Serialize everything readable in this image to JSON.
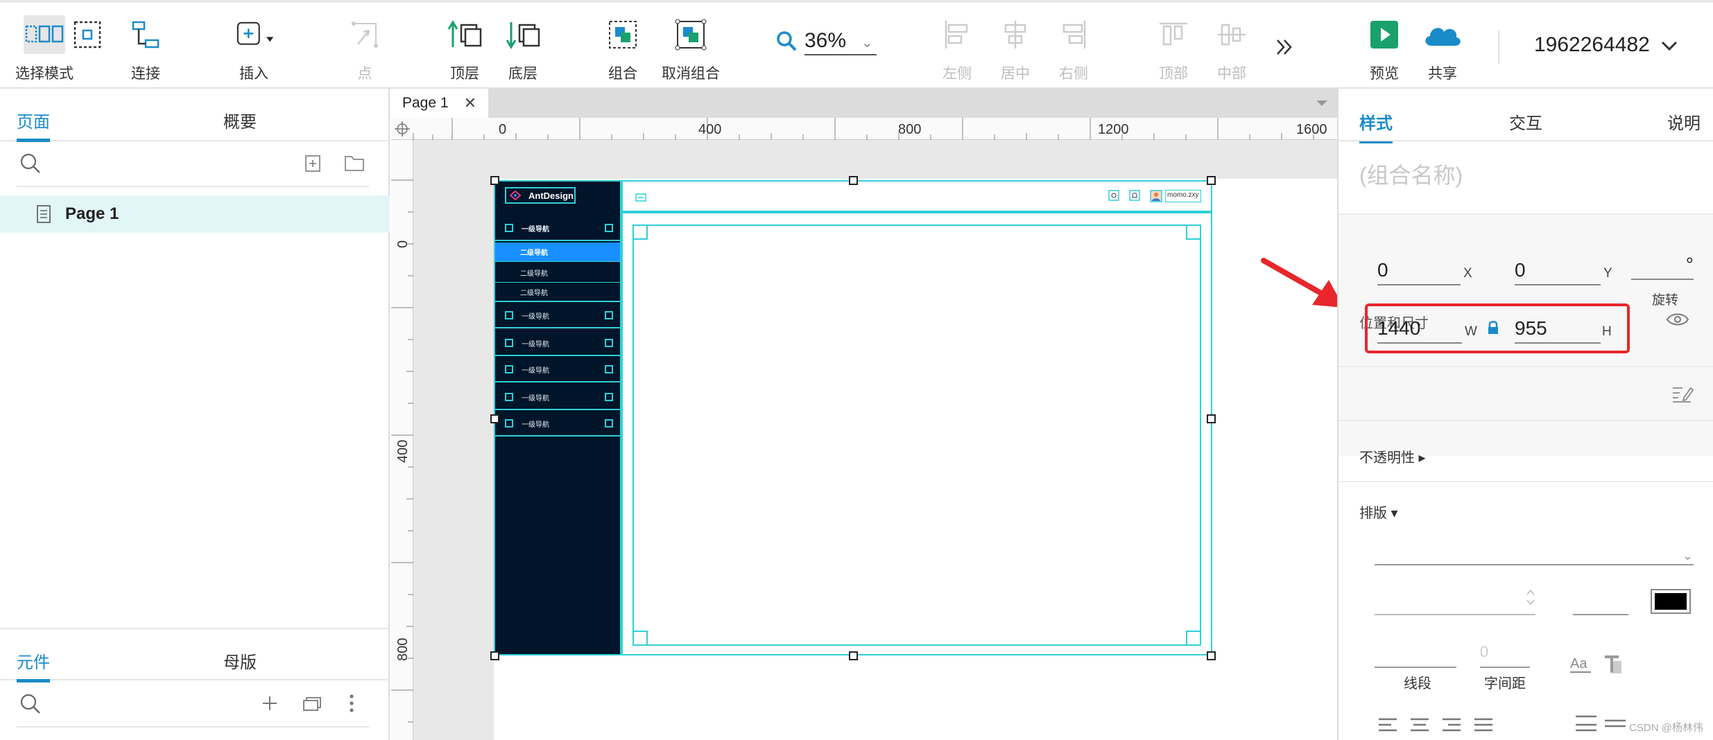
{
  "toolbar": {
    "tools": {
      "select_mode": "选择模式",
      "connect": "连接",
      "insert": "插入",
      "point": "点",
      "top_layer": "顶层",
      "bottom_layer": "底层",
      "group": "组合",
      "ungroup": "取消组合",
      "align_left": "左侧",
      "align_center": "居中",
      "align_right": "右侧",
      "align_top": "顶部",
      "align_middle": "中部",
      "preview": "预览",
      "share": "共享"
    },
    "zoom": "36%",
    "account": "1962264482",
    "accent": "#1a8bc9"
  },
  "left_panel": {
    "tabs": {
      "pages": "页面",
      "outline": "概要"
    },
    "pages": [
      {
        "label": "Page 1"
      }
    ],
    "bottom_tabs": {
      "widgets": "元件",
      "masters": "母版"
    }
  },
  "canvas": {
    "tab_label": "Page 1",
    "ruler_h": [
      "0",
      "400",
      "800",
      "1200",
      "1600"
    ],
    "ruler_v": [
      "0",
      "400",
      "800"
    ],
    "mock": {
      "logo": "AntDesign",
      "user": "momo.zxy",
      "nav": [
        "一级导航",
        "二级导航",
        "二级导航",
        "二级导航",
        "一级导航",
        "一级导航",
        "一级导航",
        "一级导航",
        "一级导航"
      ],
      "nav_active_color": "#1890ff",
      "sidebar_color": "#001529",
      "outline_color": "#2fd0d8"
    }
  },
  "right_panel": {
    "tabs": {
      "style": "样式",
      "interaction": "交互",
      "notes": "说明"
    },
    "group_name_placeholder": "(组合名称)",
    "position_size": {
      "title": "位置和尺寸",
      "x": "0",
      "x_label": "X",
      "y": "0",
      "y_label": "Y",
      "rotation": "°",
      "rotation_label": "旋转",
      "w": "1440",
      "w_label": "W",
      "h": "955",
      "h_label": "H"
    },
    "opacity_label": "不透明性 ▸",
    "typography_label": "排版 ▾",
    "typography": {
      "letter_spacing_value": "0",
      "line_label": "线段",
      "letter_spacing_label": "字间距",
      "font_color": "#000000"
    },
    "watermark": "CSDN @杨林伟"
  }
}
